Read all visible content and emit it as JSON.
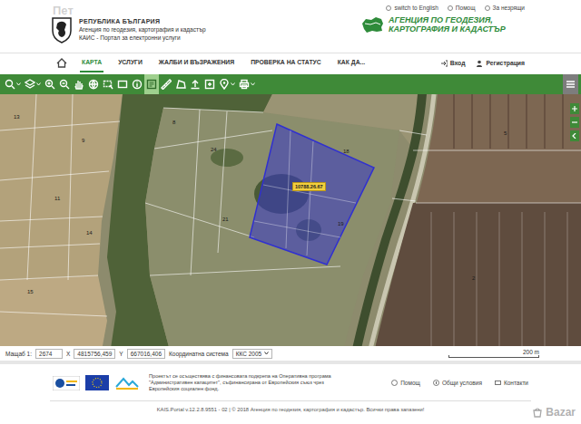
{
  "header": {
    "emblem_text": "РЕПУБЛИКА БЪЛГАРИЯ",
    "agency": "Агенция по геодезия, картография и кадастър",
    "portal": "КАИС - Портал за електронни услуги",
    "top_links": [
      "switch to English",
      "Помощ",
      "За незрящи"
    ],
    "brand": "АГЕНЦИЯ ПО ГЕОДЕЗИЯ, КАРТОГРАФИЯ И КАДАСТЪР"
  },
  "nav": {
    "items": [
      {
        "label": "КАРТА",
        "selected": true
      },
      {
        "label": "УСЛУГИ",
        "selected": false
      },
      {
        "label": "ЖАЛБИ И ВЪЗРАЖЕНИЯ",
        "selected": false
      },
      {
        "label": "ПРОВЕРКА НА СТАТУС",
        "selected": false
      },
      {
        "label": "КАК ДА...",
        "selected": false
      }
    ],
    "account": [
      "Вход",
      "Регистрация"
    ]
  },
  "toolbar": {
    "tools": [
      {
        "kind": "search",
        "dropdown": true,
        "selected": false
      },
      {
        "kind": "layers",
        "dropdown": true,
        "selected": false
      },
      {
        "kind": "zoomin",
        "dropdown": false,
        "selected": false
      },
      {
        "kind": "zoomout",
        "dropdown": false,
        "selected": false
      },
      {
        "kind": "pan",
        "dropdown": false,
        "selected": false
      },
      {
        "kind": "globe",
        "dropdown": false,
        "selected": false
      },
      {
        "kind": "selectbox",
        "dropdown": false,
        "selected": false
      },
      {
        "kind": "extent",
        "dropdown": false,
        "selected": false
      },
      {
        "kind": "info",
        "dropdown": false,
        "selected": false
      },
      {
        "kind": "identify",
        "dropdown": false,
        "selected": true
      },
      {
        "kind": "measure",
        "dropdown": false,
        "selected": false
      },
      {
        "kind": "area",
        "dropdown": false,
        "selected": false
      },
      {
        "kind": "upload",
        "dropdown": false,
        "selected": false
      },
      {
        "kind": "export",
        "dropdown": false,
        "selected": false
      },
      {
        "kind": "marker",
        "dropdown": true,
        "selected": false
      },
      {
        "kind": "print",
        "dropdown": true,
        "selected": false
      }
    ]
  },
  "map": {
    "parcel": {
      "label": "10788.26.67",
      "selected": true
    },
    "parcel_numbers": [
      "13",
      "9",
      "8",
      "11",
      "14",
      "15",
      "24",
      "21",
      "18",
      "19",
      "5",
      "2"
    ],
    "scale_bar": "200 m"
  },
  "coords": {
    "scale_label": "Мащаб 1:",
    "scale": "2674",
    "x_label": "X",
    "x": "4815756,459",
    "y_label": "Y",
    "y": "667016,406",
    "system_label": "Координатна система",
    "system": "ККС 2005"
  },
  "footer": {
    "project_text": "Проектът се осъществява с финансовата подкрепа на Оперативна програма \"Административен капацитет\", съфинансирана от Европейския съюз чрез Европейския социален фонд.",
    "links": [
      "Помощ",
      "Общи условия",
      "Контакти"
    ],
    "copyright": "KAIS.Portal v.12.2.8.9551 - 02 | © 2018 Агенция по геодезия, картография и кадастър. Всички права запазени!"
  },
  "watermarks": [
    "Пет",
    "Bazar"
  ]
}
